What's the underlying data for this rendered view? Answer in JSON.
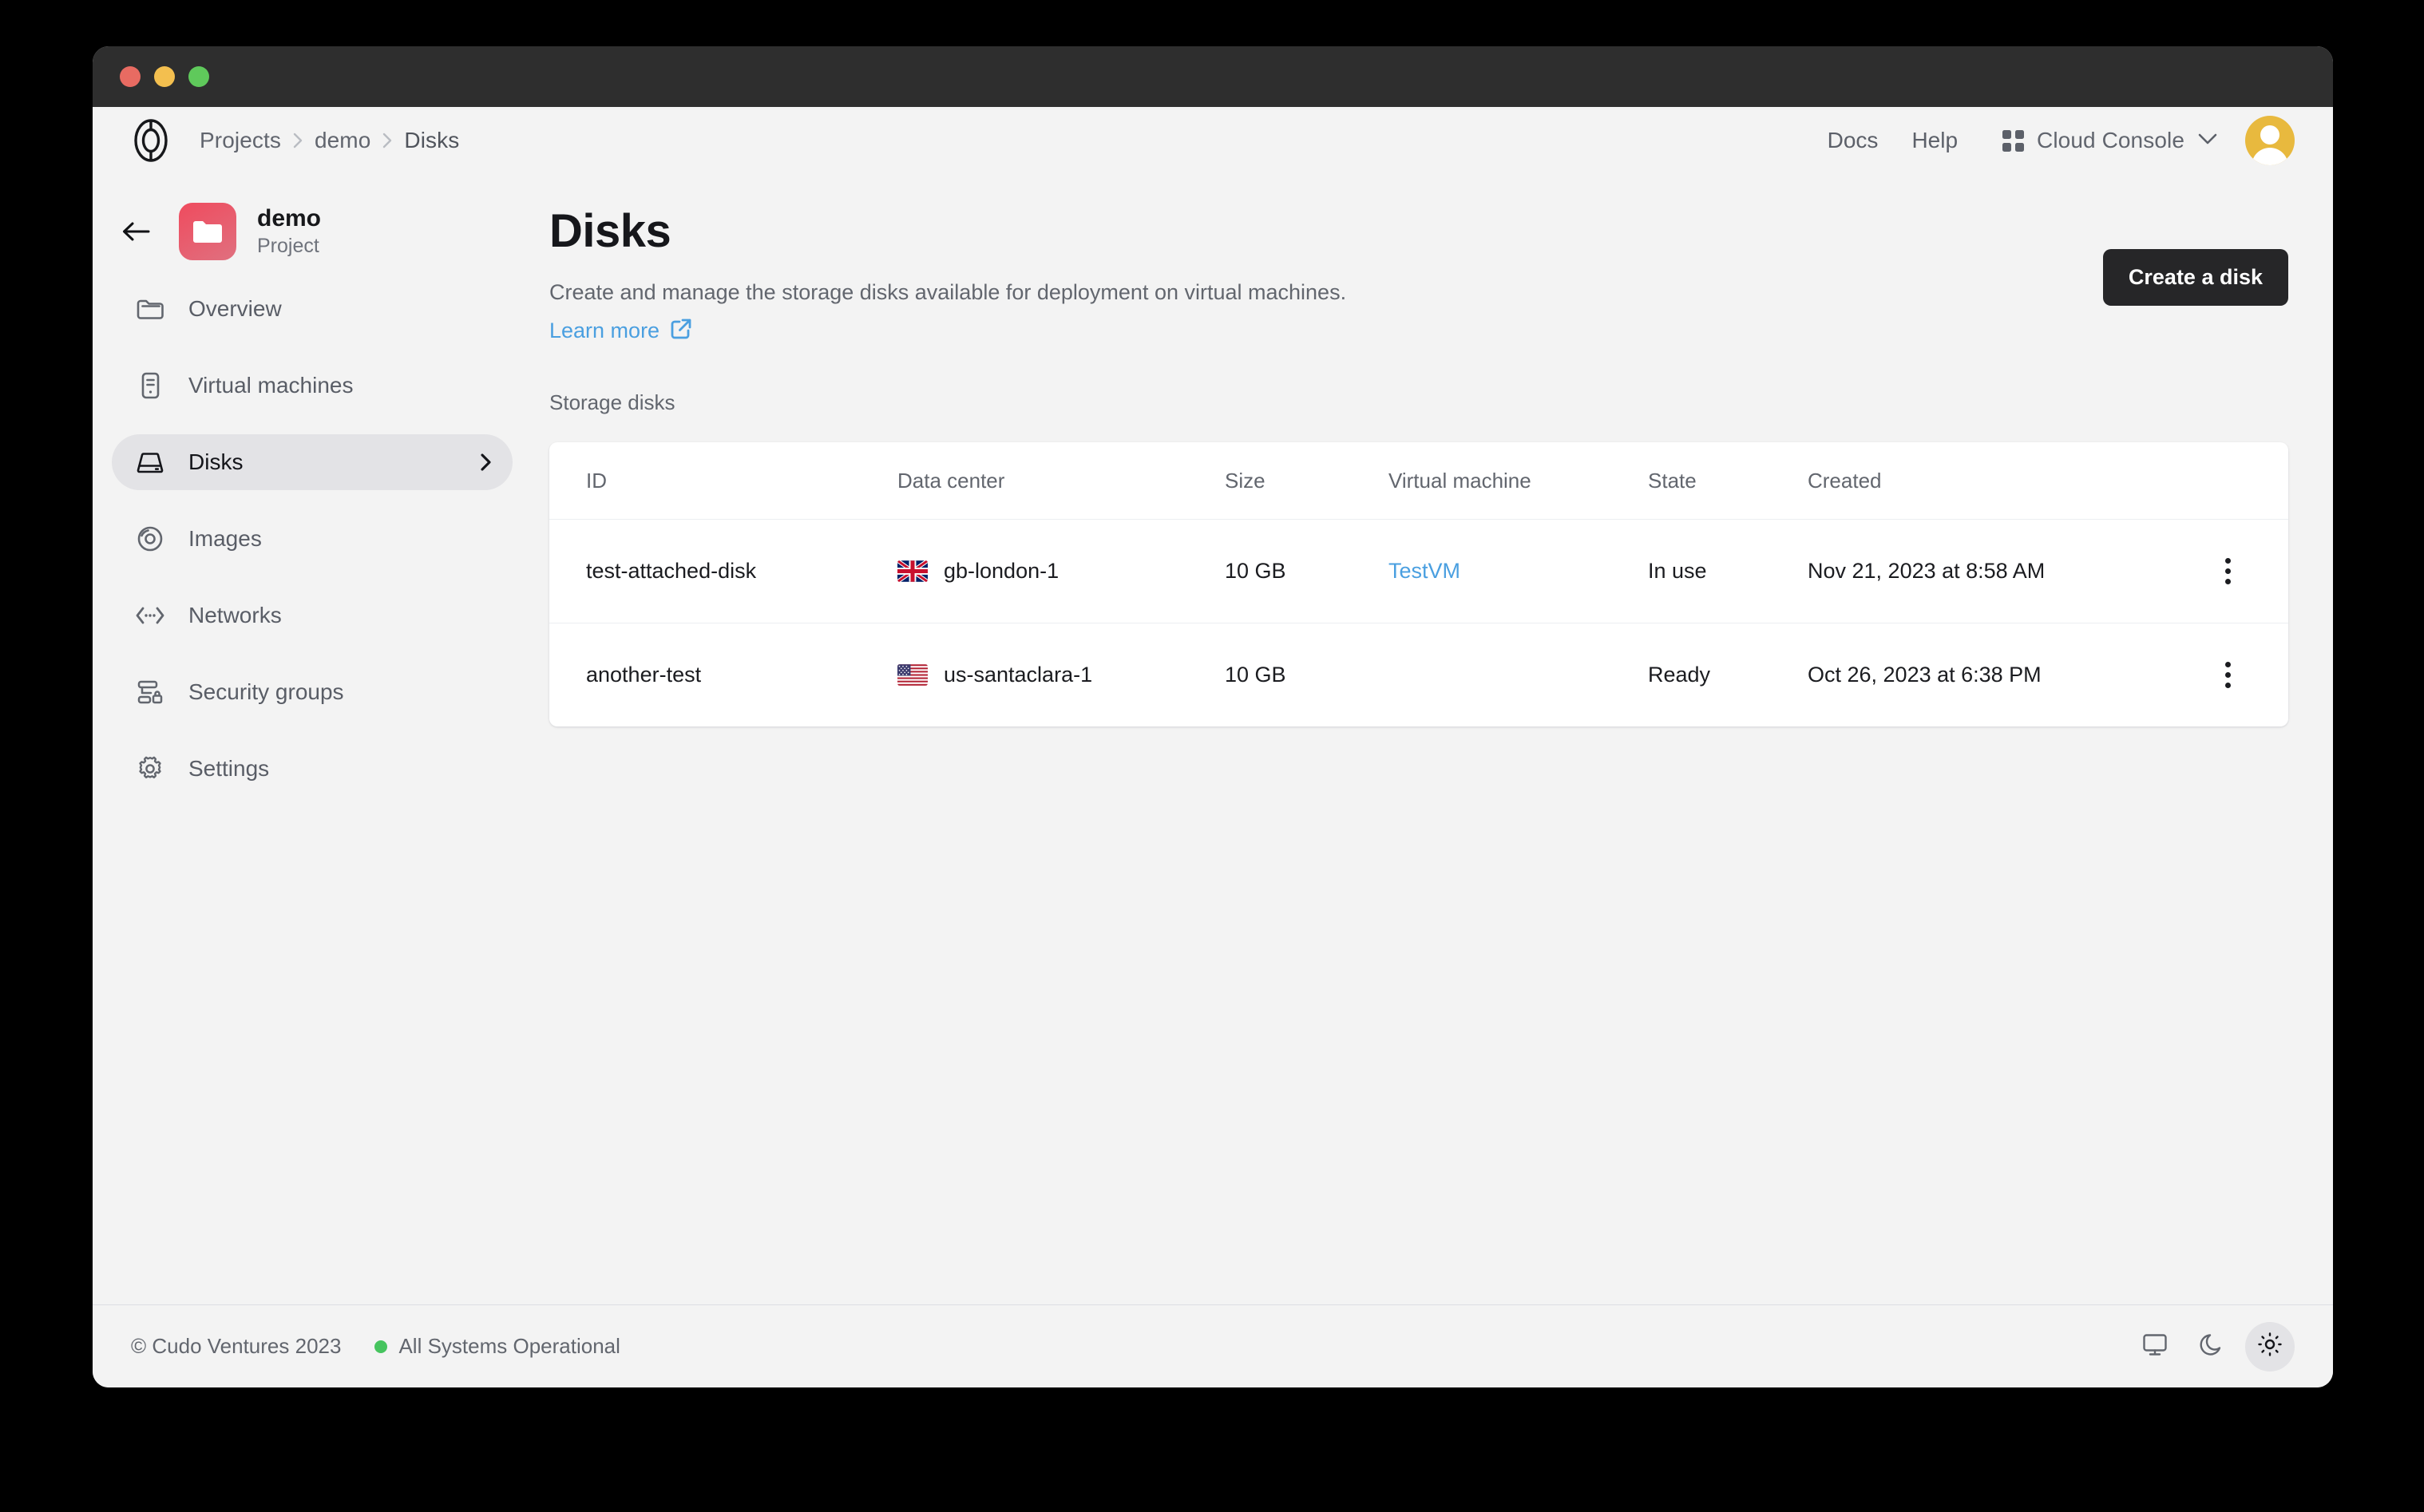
{
  "window": {
    "traffic_lights": [
      "close",
      "minimize",
      "zoom"
    ]
  },
  "header": {
    "logo": "cudo-logo",
    "breadcrumb": [
      {
        "label": "Projects"
      },
      {
        "label": "demo"
      },
      {
        "label": "Disks"
      }
    ],
    "docs_label": "Docs",
    "help_label": "Help",
    "console_label": "Cloud Console",
    "avatar": "user-avatar"
  },
  "sidebar": {
    "back": "back-arrow",
    "project_name": "demo",
    "project_sub": "Project",
    "items": [
      {
        "label": "Overview",
        "icon": "folder-icon",
        "active": false
      },
      {
        "label": "Virtual machines",
        "icon": "server-icon",
        "active": false
      },
      {
        "label": "Disks",
        "icon": "disk-icon",
        "active": true
      },
      {
        "label": "Images",
        "icon": "disc-icon",
        "active": false
      },
      {
        "label": "Networks",
        "icon": "network-icon",
        "active": false
      },
      {
        "label": "Security groups",
        "icon": "security-icon",
        "active": false
      },
      {
        "label": "Settings",
        "icon": "gear-icon",
        "active": false
      }
    ]
  },
  "main": {
    "title": "Disks",
    "description": "Create and manage the storage disks available for deployment on virtual machines.",
    "learn_more": "Learn more",
    "create_button": "Create a disk",
    "section_label": "Storage disks",
    "table": {
      "columns": [
        "ID",
        "Data center",
        "Size",
        "Virtual machine",
        "State",
        "Created"
      ],
      "rows": [
        {
          "id": "test-attached-disk",
          "flag": "gb",
          "data_center": "gb-london-1",
          "size": "10 GB",
          "virtual_machine": "TestVM",
          "state": "In use",
          "created": "Nov 21, 2023 at 8:58 AM"
        },
        {
          "id": "another-test",
          "flag": "us",
          "data_center": "us-santaclara-1",
          "size": "10 GB",
          "virtual_machine": "",
          "state": "Ready",
          "created": "Oct 26, 2023 at 6:38 PM"
        }
      ]
    }
  },
  "footer": {
    "copyright": "© Cudo Ventures 2023",
    "status": "All Systems Operational",
    "status_color": "#46c45e",
    "themes": [
      {
        "name": "system-theme",
        "icon": "monitor-icon",
        "selected": false
      },
      {
        "name": "dark-theme",
        "icon": "moon-icon",
        "selected": false
      },
      {
        "name": "light-theme",
        "icon": "sun-icon",
        "selected": true
      }
    ]
  },
  "colors": {
    "accent_link": "#4a9fe0",
    "button_dark": "#262628",
    "project_icon": "#ef4b5e",
    "avatar": "#e8b93e"
  }
}
